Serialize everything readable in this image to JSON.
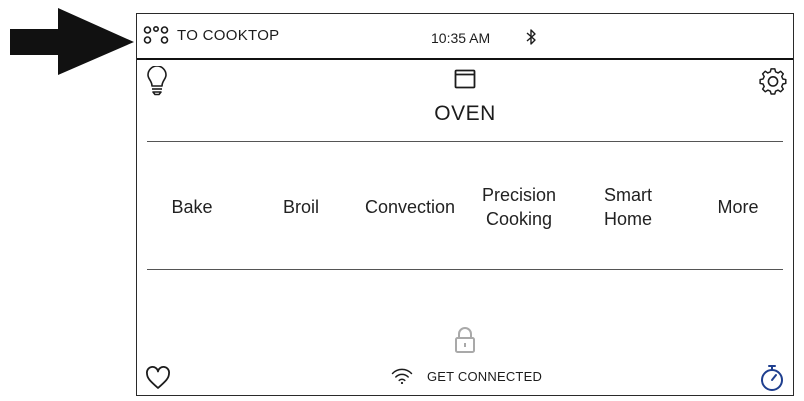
{
  "header": {
    "cooktop_label": "TO COOKTOP",
    "time": "10:35 AM"
  },
  "main": {
    "title": "OVEN",
    "modes": [
      "Bake",
      "Broil",
      "Convection",
      "Precision\nCooking",
      "Smart\nHome",
      "More"
    ]
  },
  "footer": {
    "connect_label": "GET CONNECTED"
  },
  "icons": {
    "arrow": "pointer-arrow-icon",
    "cooktop": "burners-icon",
    "bluetooth": "bluetooth-icon",
    "light": "light-bulb-icon",
    "oven": "oven-icon",
    "settings": "gear-icon",
    "lock": "lock-icon",
    "favorites": "heart-icon",
    "wifi": "wifi-icon",
    "timer": "timer-icon"
  },
  "colors": {
    "timer_accent": "#1f3f8f",
    "lock_disabled": "#a9a9a9"
  }
}
